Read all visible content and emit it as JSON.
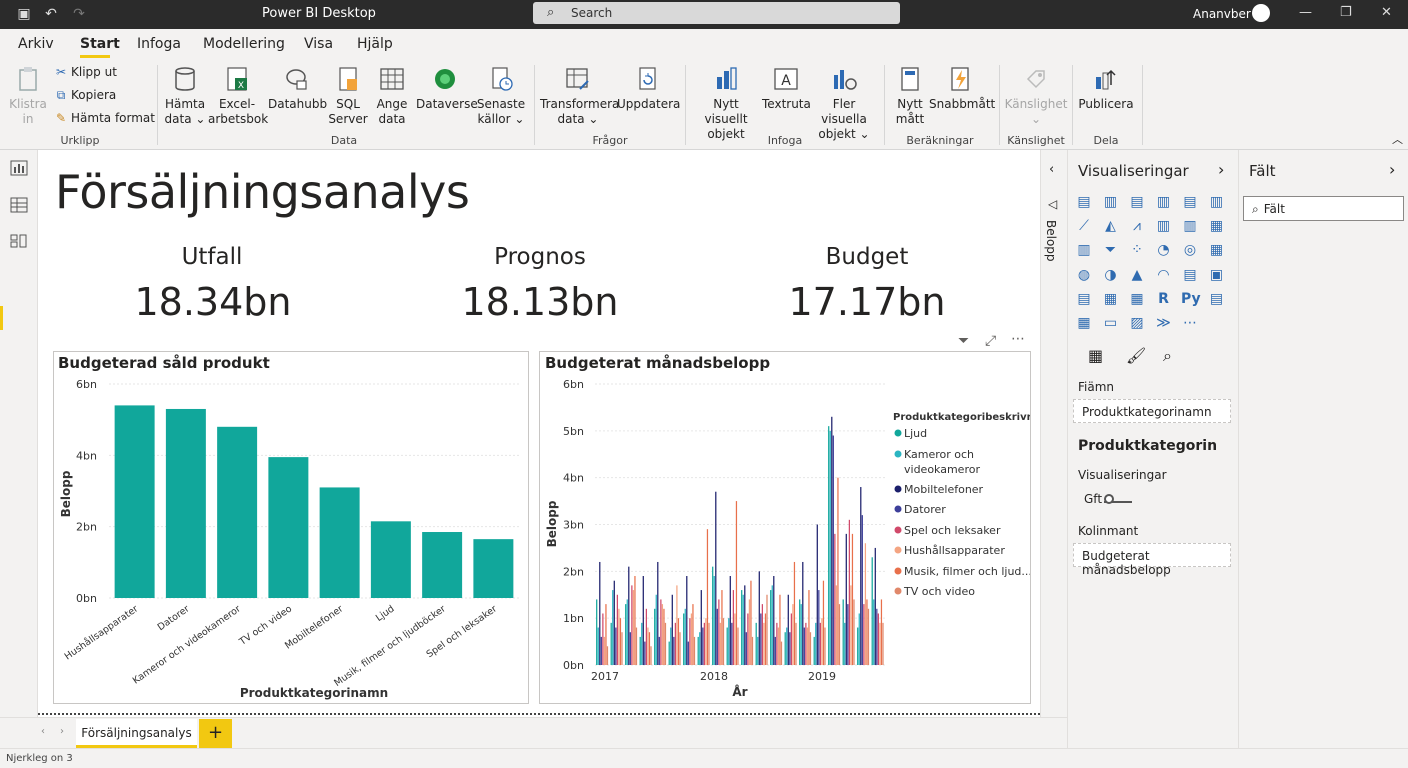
{
  "app": {
    "title": "Power BI Desktop",
    "search_placeholder": "Search",
    "user": "Ananvber"
  },
  "menu": {
    "tabs": [
      "Arkiv",
      "Start",
      "Infoga",
      "Modellering",
      "Visa",
      "Hjälp"
    ],
    "active": "Start"
  },
  "ribbon": {
    "clipboard": {
      "paste_label": "Klistra in",
      "cut": "Klipp ut",
      "copy": "Kopiera",
      "format_painter": "Hämta format",
      "group": "Urklipp"
    },
    "data": {
      "get_data": "Hämta data",
      "excel": "Excel-arbetsbok",
      "datahub": "Datahubb",
      "sql": "SQL Server",
      "enter_data": "Ange data",
      "dataverse": "Dataverse",
      "recent": "Senaste källor",
      "group": "Data"
    },
    "queries": {
      "transform": "Transformera data",
      "refresh": "Uppdatera",
      "group": "Frågor"
    },
    "insert": {
      "new_visual": "Nytt visuellt objekt",
      "textbox": "Textruta",
      "more_visuals": "Fler visuella objekt",
      "group": "Infoga"
    },
    "calculations": {
      "new_measure": "Nytt mått",
      "quick_measure": "Snabbmått",
      "group": "Beräkningar"
    },
    "sensitivity": {
      "label": "Känslighet",
      "group": "Känslighet"
    },
    "share": {
      "publish": "Publicera",
      "group": "Dela"
    }
  },
  "report": {
    "title": "Försäljningsanalys",
    "kpis": [
      {
        "label": "Utfall",
        "value": "18.34bn"
      },
      {
        "label": "Prognos",
        "value": "18.13bn"
      },
      {
        "label": "Budget",
        "value": "17.17bn"
      }
    ]
  },
  "chart_data": [
    {
      "type": "bar",
      "title": "Budgeterad såld produkt",
      "xlabel": "Produktkategorinamn",
      "ylabel": "Belopp",
      "ylim": [
        0,
        6
      ],
      "yticks": [
        "0bn",
        "2bn",
        "4bn",
        "6bn"
      ],
      "categories": [
        "Hushållsapparater",
        "Datorer",
        "Kameror och videokameror",
        "TV och video",
        "Mobiltelefoner",
        "Ljud",
        "Musik, filmer och ljudböcker",
        "Spel och leksaker"
      ],
      "values": [
        5.4,
        5.3,
        4.8,
        3.95,
        3.1,
        2.15,
        1.85,
        1.65
      ],
      "color": "#11a79b"
    },
    {
      "type": "bar",
      "title": "Budgeterat månadsbelopp",
      "xlabel": "År",
      "ylabel": "Belopp",
      "ylim": [
        0,
        6
      ],
      "yticks": [
        "0bn",
        "1bn",
        "2bn",
        "3bn",
        "4bn",
        "5bn",
        "6bn"
      ],
      "xticks": [
        "2017",
        "2018",
        "2019"
      ],
      "legend_title": "Produktkategoribeskrivning",
      "legend_position": "right",
      "series": [
        {
          "name": "Ljud",
          "color": "#11a79b",
          "values": [
            1.4,
            0.9,
            1.3,
            0.6,
            1.2,
            0.5,
            1.1,
            0.6,
            2.1,
            0.8,
            1.6,
            0.9,
            1.6,
            0.7,
            1.4,
            0.6,
            5.1,
            1.4,
            0.8,
            2.3
          ]
        },
        {
          "name": "Kameror och videokameror",
          "color": "#2bb5c2",
          "values": [
            0.8,
            1.6,
            1.4,
            0.9,
            1.5,
            0.8,
            1.2,
            0.7,
            1.9,
            1.0,
            1.5,
            0.6,
            1.7,
            0.8,
            1.3,
            0.9,
            5.0,
            0.9,
            1.1,
            1.4
          ]
        },
        {
          "name": "Mobiltelefoner",
          "color": "#1b1f6b",
          "values": [
            2.2,
            1.8,
            2.1,
            1.9,
            2.2,
            1.5,
            1.9,
            1.6,
            3.7,
            1.9,
            1.7,
            2.0,
            1.9,
            1.5,
            2.2,
            3.0,
            5.3,
            2.8,
            3.8,
            2.5
          ]
        },
        {
          "name": "Datorer",
          "color": "#3d3f9a",
          "values": [
            0.6,
            0.8,
            0.7,
            0.5,
            0.6,
            0.6,
            0.5,
            0.8,
            1.2,
            0.9,
            0.7,
            1.1,
            0.6,
            0.7,
            0.8,
            1.6,
            4.9,
            1.3,
            3.2,
            1.2
          ]
        },
        {
          "name": "Spel och leksaker",
          "color": "#d1496a",
          "values": [
            1.1,
            1.5,
            1.7,
            1.2,
            1.4,
            0.9,
            1.0,
            0.9,
            1.4,
            1.6,
            1.1,
            1.3,
            0.9,
            1.1,
            0.9,
            0.9,
            2.8,
            3.1,
            1.3,
            1.1
          ]
        },
        {
          "name": "Hushållsapparater",
          "color": "#f4a582",
          "values": [
            0.6,
            1.2,
            1.6,
            0.8,
            1.3,
            1.7,
            1.1,
            1.0,
            0.9,
            1.1,
            1.4,
            0.9,
            0.8,
            1.3,
            0.8,
            1.0,
            1.7,
            1.7,
            2.6,
            0.9
          ]
        },
        {
          "name": "Musik, filmer och ljud...",
          "color": "#e8704b",
          "values": [
            1.3,
            1.0,
            1.9,
            0.7,
            1.2,
            1.0,
            1.3,
            2.9,
            1.6,
            3.5,
            1.8,
            1.1,
            1.5,
            2.2,
            1.6,
            1.8,
            4.0,
            2.8,
            1.4,
            1.4
          ]
        },
        {
          "name": "TV och video",
          "color": "#e0886a",
          "values": [
            0.4,
            0.7,
            0.8,
            0.4,
            0.9,
            0.7,
            0.6,
            0.9,
            1.0,
            0.8,
            0.6,
            1.5,
            0.5,
            0.9,
            0.7,
            0.8,
            1.3,
            1.4,
            1.2,
            0.9
          ]
        }
      ]
    }
  ],
  "right": {
    "collapsed_label": "Belopp",
    "viz_title": "Visualiseringar",
    "fields_title": "Fält",
    "fields_search": "Fält",
    "well1_label": "Fiämn",
    "well1_value": "Produktkategorinamn",
    "section": "Produktkategorin",
    "sub_label": "Visualiseringar",
    "toggle_label": "Gft",
    "well2_label": "Kolinmant",
    "well2_value": "Budgeterat månadsbelopp"
  },
  "tabs": {
    "page": "Försäljningsanalys",
    "add": "+"
  },
  "status": {
    "text": "Njerkleg on 3"
  },
  "colors": {
    "accent": "#f2c811",
    "teal": "#11a79b",
    "titlebar": "#2b2b2b"
  }
}
